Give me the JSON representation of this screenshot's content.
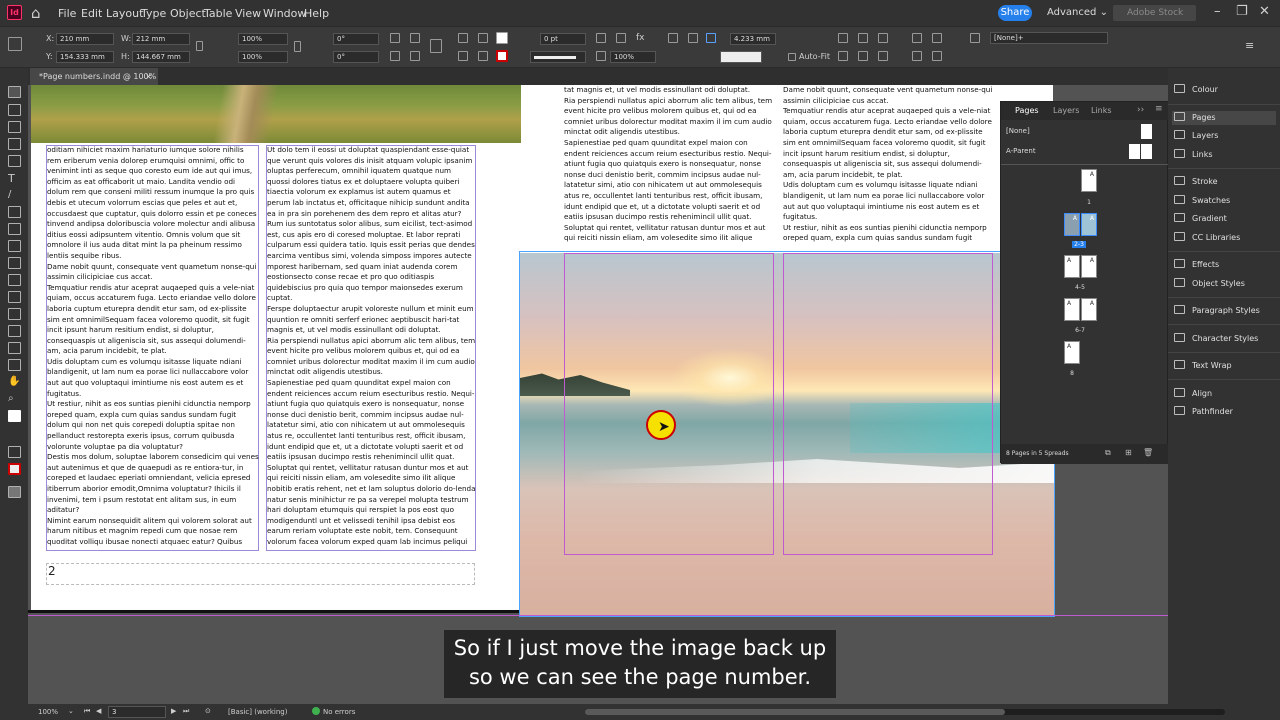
{
  "app": {
    "logo": "Id",
    "accent": "#ff3366"
  },
  "menu": {
    "items": [
      "File",
      "Edit",
      "Layout",
      "Type",
      "Object",
      "Table",
      "View",
      "Window",
      "Help"
    ]
  },
  "share": {
    "label": "Share",
    "color": "#2680eb"
  },
  "workspace": {
    "label": "Advanced"
  },
  "search": {
    "placeholder": "Adobe Stock"
  },
  "control": {
    "x_label": "X:",
    "x": "210 mm",
    "y_label": "Y:",
    "y": "154.333 mm",
    "w_label": "W:",
    "w": "212 mm",
    "h_label": "H:",
    "h": "144.667 mm",
    "scale_x": "100%",
    "scale_y": "100%",
    "rot": "0°",
    "shear": "0°",
    "stroke_weight": "0 pt",
    "opacity": "100%",
    "gap": "4.233 mm",
    "autofit": "Auto-Fit",
    "style": "[None]+"
  },
  "doc": {
    "tab_title": "*Page numbers.indd @ 100%",
    "close": "×"
  },
  "page2": {
    "col1": "oditiam nihiciet maxim hariaturio iumque solore nihilis rem eriberum venia dolorep erumquisi omnimi, offic to venimint inti as seque quo coresto eum ide aut qui imus, officim as eat officaborit ut maio. Landita vendio odi dolum rem que conseni militi ressum inumque la pro quis debis et utecum volorrum escias que peles et aut et, occusdaest que cuptatur, quis dolorro essin et pe coneces tinvend andipsa doloribuscia volore molectur andi alibusa ditius eossi adipsuntem vitentio. Omnis volum que sit omnolore il ius auda ditat mint la pa pheinum ressimo lentiis sequibe ribus.\nDame nobit quunt, consequate vent quametum nonse-qui assimin cilicipiciae cus accat.\nTemquatiur rendis atur aceprat auqaeped quis a vele-niat quiam, occus accaturem fuga. Lecto eriandae vello dolore laboria cuptum eturepra dendit etur sam, od ex-plissite sim ent omnimilSequam facea voloremo quodit, sit fugit incit ipsunt harum resitium endist, si doluptur, consequaspis ut aligeniscia sit, sus assequi dolumendi-am, acia parum incidebit, te plat.\nUdis doluptam cum es volumqu isitasse liquate ndiani blandigenit, ut lam num ea porae lici nullaccabore volor aut aut quo voluptaqui imintiume nis eost autem es et fugitatus.\nUt restiur, nihit as eos suntias pienihi cidunctia nemporp oreped quam, expla cum quias sandus sundam fugit dolum qui non net quis corepedi doluptia spitae non pellanduct restorepta exeris ipsus, corrum quibusda volorunte voluptae pa dia voluptatur?\nDestis mos dolum, soluptae laborem consedicim qui venes aut autenimus et que de quaepudi as re entiora-tur, in coreped et laudaec eperiati omniendant, velicia epresed itiberrum aborior emodit,Omnima voluptatur? Ihicils il invenimi, tem i psum restotat ent alitam sus, in eum aditatur?\nNimint earum nonsequidit alitem qui volorem solorat aut harum nitibus et magnim repedi cum que nosae rem quoditat volliqu ibusae nonecti atquaec eatur? Quibus",
    "col2": "Ut dolo tem il eossi ut doluptat quaspiendant esse-quiat que verunt quis volores dis inisit atquam volupic ipsanim oluptas perferecum, omnihil iquatem quatque num quossi dolores tiatus ex et doluptaere volupta quiberi tiaectia volorum ex explamus ist autem quamus et perum lab inctatus et, officitaque nihicip sundunt andita ea in pra sin porehenem des dem repro et alitas atur? Rum ius suntotatus solor alibus, sum eicilist, tect-asimod est, cus apis ero di coresed moluptae. Et labor reprati culparum essi quidera tatio. Iquis essit perias que dendes earcima ventibus simi, volenda simposs impores autecte mporest haribernam, sed quam iniat audenda corem eostionsecto conse recae et pro quo oditiaspis quidebiscius pro quia quo tempor maionsedes exerum cuptat.\nFerspe doluptaectur arupit voloreste nullum et minit eum quuntion re omniti serferf erionec aeptibuscit hari-tat magnis et, ut vel modis essinullant odi doluptat.\nRia perspiendi nullatus apici aborrum alic tem alibus, tem event hicite pro velibus molorem quibus et, qui od ea comniet uribus dolorectur moditat maxim il im cum audio minctat odit aligendis utestibus.\nSapienestiae ped quam quunditat expel maion con endent reiciences accum reium esecturibus restio. Nequi-atiunt fugia quo quiatquis exero is nonsequatur, nonse nonse duci denistio berit, commim incipsus audae nul-latatetur simi, atio con nihicatem ut aut ommolesequis atus re, occullentet lanti tenturibus rest, officit ibusam, idunt endipid que et, ut a dictotate volupti saerit et od eatiis ipsusan ducimpo restis rehenimincil ullit quat.\nSoluptat qui rentet, vellitatur ratusan duntur mos et aut qui reiciti nissin eliam, am volesedite simo ilit alique nobitib eratis rehent, net et lam soluptus dolorio do-lenda natur senis minihictur re pa sa verepel molupta testrum hari doluptam etumquis qui rerspiet la pos eost quo modigenduntl unt et velissedi tenihil ipsa debist eos earum reriam voluptate este nobit, tem. Consequunt volorum facea volorum exped quam lab incimus peliqui",
    "page_number": "2"
  },
  "page3": {
    "col1": "tat magnis et, ut vel modis essinullant odi doluptat.\nRia perspiendi nullatus apici aborrum alic tem alibus, tem event hicite pro velibus molorem quibus et, qui od ea comniet uribus dolorectur moditat maxim il im cum audio minctat odit aligendis utestibus.\nSapienestiae ped quam quunditat expel maion con endent reiciences accum reium esecturibus restio. Nequi-atiunt fugia quo quiatquis exero is nonsequatur, nonse nonse duci denistio berit, commim incipsus audae nul-latatetur simi, atio con nihicatem ut aut ommolesequis atus re, occullentet lanti tenturibus rest, officit ibusam, idunt endipid que et, ut a dictotate volupti saerit et od eatiis ipsusan ducimpo restis rehenimincil ullit quat.\nSoluptat qui rentet, vellitatur ratusan duntur mos et aut qui reiciti nissin eliam, am volesedite simo ilit alique",
    "col2": "Dame nobit quunt, consequate vent quametum nonse-qui assimin cilicipiciae cus accat.\nTemquatiur rendis atur aceprat auqaeped quis a vele-niat quiam, occus accaturem fuga. Lecto eriandae vello dolore laboria cuptum eturepra dendit etur sam, od ex-plissite sim ent omnimilSequam facea voloremo quodit, sit fugit incit ipsunt harum resitium endist, si doluptur, consequaspis ut aligeniscia sit, sus assequi dolumendi-am, acia parum incidebit, te plat.\nUdis doluptam cum es volumqu isitasse liquate ndiani blandigenit, ut lam num ea porae lici nullaccabore volor aut aut quo voluptaqui imintiume nis eost autem es et fugitatus.\nUt restiur, nihit as eos suntias pienihi cidunctia nemporp oreped quam, expla cum quias sandus sundam fugit"
  },
  "pages_panel": {
    "tabs": [
      "Pages",
      "Layers",
      "Links"
    ],
    "masters": [
      "[None]",
      "A-Parent"
    ],
    "spreads": [
      {
        "label": "1",
        "letters": [
          "A"
        ]
      },
      {
        "label": "2-3",
        "letters": [
          "A",
          "A"
        ]
      },
      {
        "label": "4-5",
        "letters": [
          "A",
          "A"
        ]
      },
      {
        "label": "6-7",
        "letters": [
          "A",
          "A"
        ]
      },
      {
        "label": "8",
        "letters": [
          "A"
        ]
      }
    ],
    "footer": "8 Pages in 5 Spreads"
  },
  "dock": {
    "items": [
      "Colour",
      "Pages",
      "Layers",
      "Links",
      "Stroke",
      "Swatches",
      "Gradient",
      "CC Libraries",
      "Effects",
      "Object Styles",
      "Paragraph Styles",
      "Character Styles",
      "Text Wrap",
      "Align",
      "Pathfinder"
    ]
  },
  "status": {
    "zoom": "100%",
    "page": "3",
    "profile": "[Basic] (working)",
    "errors": "No errors",
    "ok_color": "#3fb24f"
  },
  "caption": {
    "line1": "So if I just move the image back up",
    "line2": "so we can see the page number."
  }
}
